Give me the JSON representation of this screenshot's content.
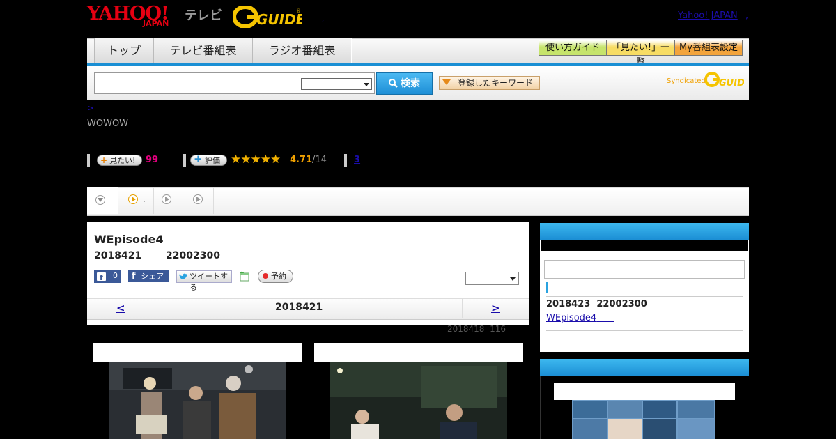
{
  "header": {
    "logo_yahoo": "YAHOO!",
    "logo_japan": "JAPAN",
    "logo_tv": "テレビ",
    "logo_gguide": "G-GUIDE",
    "yahoo_japan_link": "Yahoo! JAPAN",
    "link_sep": ",",
    "small_dot": ","
  },
  "nav": {
    "tabs": [
      "トップ",
      "テレビ番組表",
      "ラジオ番組表"
    ],
    "right_buttons": [
      "使い方ガイド",
      "「見たい!」一覧",
      "My番組表設定"
    ],
    "right_button_colors": [
      "#c6e46c",
      "#f7dc64",
      "#f3a43c"
    ]
  },
  "search": {
    "input_value": "",
    "select_value": "",
    "button_label": "検索",
    "keyword_button": "登録したキーワード",
    "syndicated": "Syndicated"
  },
  "breadcrumb": {
    "sep": ">"
  },
  "channel": "WOWOW",
  "ratings": {
    "mitai_label": "見たい!",
    "mitai_count": "99",
    "hyoka_label": "評価",
    "stars": "★★★★★",
    "star_value": 4.71,
    "score": "4.71",
    "score_count": "/14",
    "link": "3"
  },
  "tabs_strip": {
    "tab2_text": "."
  },
  "program": {
    "title": "WEpisode4",
    "date": "2018421",
    "time": "22002300",
    "fb_count": "0",
    "fb_share": "シェア",
    "tweet": "ツイートする",
    "reserve": "予約",
    "select_value": ""
  },
  "date_nav": {
    "prev": "<",
    "date": "2018421",
    "next": ">"
  },
  "meta": {
    "date": "2018418",
    "count": "116"
  },
  "sidebar": {
    "input_value": "",
    "next_date": "2018423",
    "next_time": "22002300",
    "next_link": "WEpisode4"
  },
  "colors": {
    "accent_blue": "#1a8fd4",
    "link": "#1a0dab",
    "mitai_pink": "#e4007f",
    "star": "#f0b000"
  }
}
